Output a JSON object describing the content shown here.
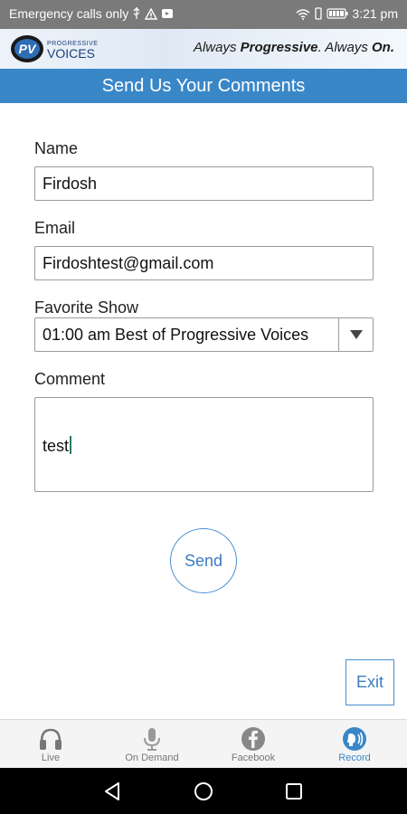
{
  "status_bar": {
    "carrier_text": "Emergency calls only",
    "time": "3:21 pm"
  },
  "banner": {
    "logo_mark": "PV",
    "logo_line1": "PROGRESSIVE",
    "logo_line2": "VOICES",
    "tagline_a": "Always ",
    "tagline_b": "Progressive",
    "tagline_c": ". Always ",
    "tagline_d": "On."
  },
  "page": {
    "title": "Send Us Your Comments"
  },
  "form": {
    "name_label": "Name",
    "name_value": "Firdosh",
    "email_label": "Email",
    "email_value": "Firdoshtest@gmail.com",
    "show_label": "Favorite Show",
    "show_value": "01:00 am Best of Progressive Voices",
    "comment_label": "Comment",
    "comment_value": "test",
    "send_label": "Send"
  },
  "exit_label": "Exit",
  "tabs": [
    {
      "label": "Live",
      "icon": "headphones-icon",
      "active": false
    },
    {
      "label": "On Demand",
      "icon": "microphone-icon",
      "active": false
    },
    {
      "label": "Facebook",
      "icon": "facebook-icon",
      "active": false
    },
    {
      "label": "Record",
      "icon": "record-voice-icon",
      "active": true
    }
  ],
  "colors": {
    "accent": "#3a87c8",
    "status_bar": "#7a7a7a",
    "nav_bar": "#000000"
  }
}
